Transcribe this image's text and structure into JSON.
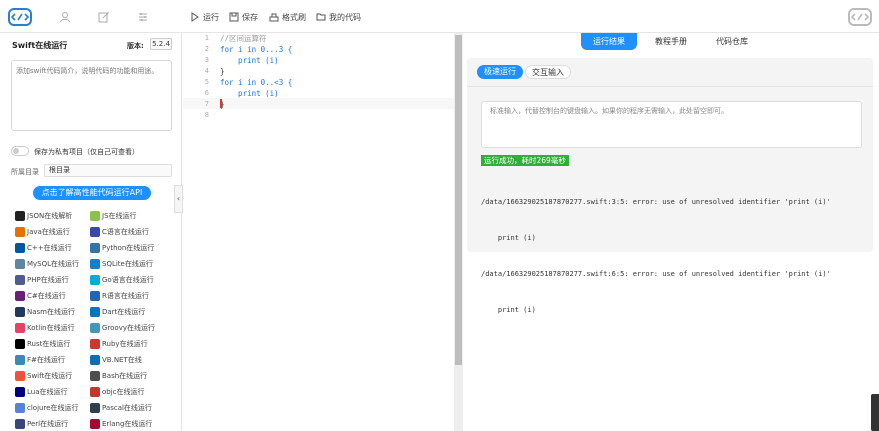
{
  "toolbar": {
    "run": "运行",
    "save": "保存",
    "format": "格式刷",
    "my_code": "我的代码"
  },
  "left": {
    "title": "Swift在线运行",
    "version_label": "版本:",
    "version": "5.2.4",
    "desc_placeholder": "添加swift代码简介，说明代码的功能和用途。",
    "private_label": "保存为私有项目（仅自己可查看）",
    "dir_label": "所属目录",
    "dir_value": "根目录",
    "api_button": "点击了解高性能代码运行API",
    "collapse": "‹",
    "langs": [
      {
        "label": "JSON在线解析",
        "icon": "json-icon",
        "color": "#222"
      },
      {
        "label": "JS在线运行",
        "icon": "js-icon",
        "color": "#8bc34a"
      },
      {
        "label": "Java在线运行",
        "icon": "java-icon",
        "color": "#e76f00"
      },
      {
        "label": "C语言在线运行",
        "icon": "c-icon",
        "color": "#3949ab"
      },
      {
        "label": "C++在线运行",
        "icon": "cpp-icon",
        "color": "#00599c"
      },
      {
        "label": "Python在线运行",
        "icon": "python-icon",
        "color": "#3572a5"
      },
      {
        "label": "MySQL在线运行",
        "icon": "mysql-icon",
        "color": "#5d87a1"
      },
      {
        "label": "SQLite在线运行",
        "icon": "sqlite-icon",
        "color": "#0f80cc"
      },
      {
        "label": "PHP在线运行",
        "icon": "php-icon",
        "color": "#4f5b93"
      },
      {
        "label": "Go语言在线运行",
        "icon": "go-icon",
        "color": "#00add8"
      },
      {
        "label": "C#在线运行",
        "icon": "csharp-icon",
        "color": "#68217a"
      },
      {
        "label": "R语言在线运行",
        "icon": "r-icon",
        "color": "#2165b6"
      },
      {
        "label": "Nasm在线运行",
        "icon": "nasm-icon",
        "color": "#1f3a5f"
      },
      {
        "label": "Dart在线运行",
        "icon": "dart-icon",
        "color": "#0175c2"
      },
      {
        "label": "Kotlin在线运行",
        "icon": "kotlin-icon",
        "color": "#e24462"
      },
      {
        "label": "Groovy在线运行",
        "icon": "groovy-icon",
        "color": "#4298b8"
      },
      {
        "label": "Rust在线运行",
        "icon": "rust-icon",
        "color": "#000000"
      },
      {
        "label": "Ruby在线运行",
        "icon": "ruby-icon",
        "color": "#cc342d"
      },
      {
        "label": "F#在线运行",
        "icon": "fsharp-icon",
        "color": "#378bba"
      },
      {
        "label": "VB.NET在线",
        "icon": "vbnet-icon",
        "color": "#0e6cb5"
      },
      {
        "label": "Swift在线运行",
        "icon": "swift-icon",
        "color": "#f05138"
      },
      {
        "label": "Bash在线运行",
        "icon": "bash-icon",
        "color": "#4e4e4e"
      },
      {
        "label": "Lua在线运行",
        "icon": "lua-icon",
        "color": "#000080"
      },
      {
        "label": "objc在线运行",
        "icon": "objc-icon",
        "color": "#c0392b"
      },
      {
        "label": "clojure在线运行",
        "icon": "clojure-icon",
        "color": "#5881d8"
      },
      {
        "label": "Pascal在线运行",
        "icon": "pascal-icon",
        "color": "#2c3e50"
      },
      {
        "label": "Perl在线运行",
        "icon": "perl-icon",
        "color": "#39457e"
      },
      {
        "label": "Erlang在线运行",
        "icon": "erlang-icon",
        "color": "#a90533"
      }
    ]
  },
  "editor": {
    "lines": [
      {
        "n": "1",
        "text": "//区间运算符"
      },
      {
        "n": "2",
        "text": "for i in 0...3 {"
      },
      {
        "n": "3",
        "text": "    print (i)"
      },
      {
        "n": "4",
        "text": "}"
      },
      {
        "n": "5",
        "text": "for i in 0..<3 {"
      },
      {
        "n": "6",
        "text": "    print (i)"
      },
      {
        "n": "7",
        "text": "}"
      },
      {
        "n": "8",
        "text": ""
      }
    ]
  },
  "right": {
    "tabs": [
      "运行结果",
      "教程手册",
      "代码仓库"
    ],
    "subtabs": [
      "极速运行",
      "交互输入"
    ],
    "stdin_placeholder": "标准输入，代替控制台的键盘输入。如果你的程序无需输入，此处留空即可。",
    "success": "运行成功，耗时269毫秒",
    "output": [
      "/data/166329025187870277.swift:3:5: error: use of unresolved identifier 'print (i)'",
      "    print (i)",
      "/data/166329025187870277.swift:6:5: error: use of unresolved identifier 'print (i)'",
      "    print (i)"
    ]
  },
  "colors": {
    "accent": "#1e90ff",
    "success": "#2eaf36"
  }
}
